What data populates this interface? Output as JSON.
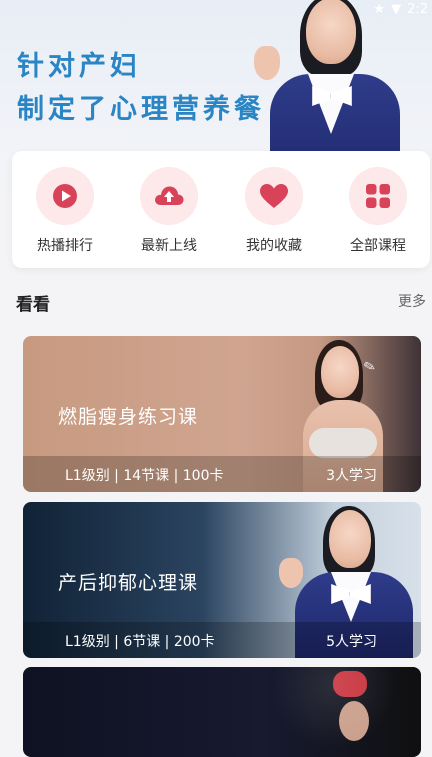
{
  "status_bar": {
    "time": "2:2"
  },
  "hero": {
    "line1": "针对产妇",
    "line2": "制定了心理营养餐"
  },
  "categories": [
    {
      "label": "热播排行",
      "icon": "play-icon"
    },
    {
      "label": "最新上线",
      "icon": "cloud-upload-icon"
    },
    {
      "label": "我的收藏",
      "icon": "heart-icon"
    },
    {
      "label": "全部课程",
      "icon": "grid-icon"
    }
  ],
  "section": {
    "title": "看看",
    "more": "更多"
  },
  "courses": [
    {
      "title": "燃脂瘦身练习课",
      "meta": "L1级别 | 14节课 | 100卡",
      "learners": "3人学习"
    },
    {
      "title": "产后抑郁心理课",
      "meta": "L1级别 | 6节课 | 200卡",
      "learners": "5人学习"
    },
    {
      "title": ""
    }
  ],
  "colors": {
    "accent_blue": "#2a85c4",
    "icon_red": "#d9435a",
    "icon_bg": "#fde8ea"
  }
}
